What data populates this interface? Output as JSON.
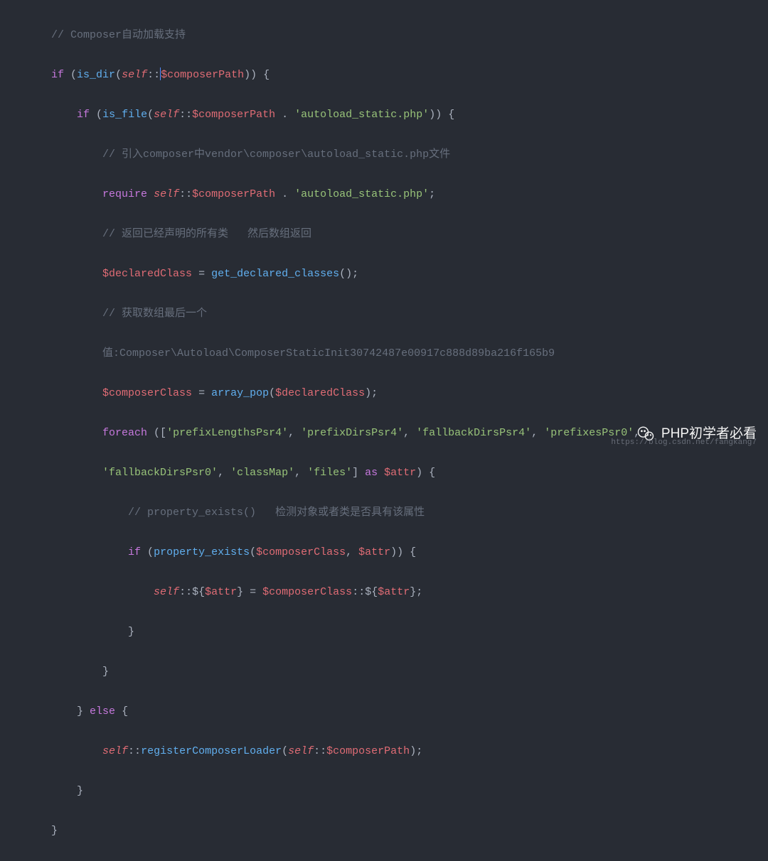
{
  "watermark": {
    "text": "PHP初学者必看",
    "url": "https://blog.csdn.net/fangkang7"
  },
  "indent": {
    "l2": "        ",
    "l3": "            ",
    "l4": "                ",
    "l5": "                    ",
    "l6": "                        "
  },
  "code": {
    "l1_comment": "// Composer自动加载支持",
    "l2_if": "if",
    "l2_fn": "is_dir",
    "l2_self": "self",
    "l2_dcolon": "::",
    "l2_prop": "$composerPath",
    "l2_tail": ")) {",
    "l3_if": "if",
    "l3_fn": "is_file",
    "l3_self": "self",
    "l3_prop": "$composerPath",
    "l3_concat": " . ",
    "l3_str": "'autoload_static.php'",
    "l3_tail": ")) {",
    "l4_comment": "// 引入composer中vendor\\composer\\autoload_static.php文件",
    "l5_require": "require",
    "l5_self": "self",
    "l5_prop": "$composerPath",
    "l5_concat": " . ",
    "l5_str": "'autoload_static.php'",
    "l5_semi": ";",
    "l6_comment": "// 返回已经声明的所有类   然后数组返回",
    "l7_var": "$declaredClass",
    "l7_eq": " = ",
    "l7_fn": "get_declared_classes",
    "l7_tail": "();",
    "l8_comment": "// 获取数组最后一个",
    "l9_part1": "值:Composer\\Autoload\\ComposerStaticInit30742487e00917c888d89ba216f165b9",
    "l10_var": "$composerClass",
    "l10_eq": " = ",
    "l10_fn": "array_pop",
    "l10_arg": "$declaredClass",
    "l10_tail": ");",
    "l11_foreach": "foreach",
    "l11_open": " ([",
    "l11_s1": "'prefixLengthsPsr4'",
    "l11_s2": "'prefixDirsPsr4'",
    "l11_s3": "'fallbackDirsPsr4'",
    "l11_s4": "'prefixesPsr0'",
    "l11_comma": ", ",
    "l12_s5": "'fallbackDirsPsr0'",
    "l12_s6": "'classMap'",
    "l12_s7": "'files'",
    "l12_close": "] ",
    "l12_as": "as",
    "l12_var": " $attr",
    "l12_tail": ") {",
    "l13_comment": "// property_exists()   检测对象或者类是否具有该属性",
    "l14_if": "if",
    "l14_fn": "property_exists",
    "l14_arg1": "$composerClass",
    "l14_comma": ", ",
    "l14_arg2": "$attr",
    "l14_tail": ")) {",
    "l15_self": "self",
    "l15_dcolon": "::",
    "l15_dollar": "$",
    "l15_l": "{",
    "l15_attr": "$attr",
    "l15_r": "}",
    "l15_eq": " = ",
    "l15_var2": "$composerClass",
    "l15_semi": ";",
    "l16_brace": "}",
    "l17_brace": "}",
    "l18_brace": "} ",
    "l18_else": "else",
    "l18_open": " {",
    "l19_self": "self",
    "l19_fn": "registerComposerLoader",
    "l19_self2": "self",
    "l19_prop": "$composerPath",
    "l19_tail": ");",
    "l20_brace": "}",
    "l21_brace": "}"
  }
}
